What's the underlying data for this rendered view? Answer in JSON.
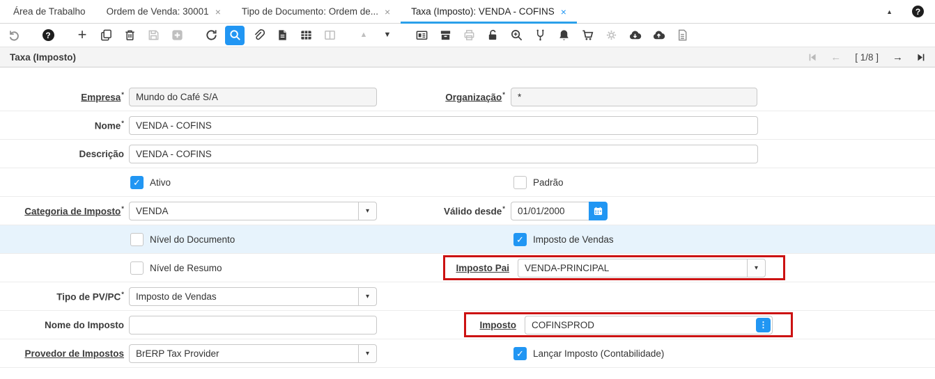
{
  "colors": {
    "accent_blue": "#2196f3",
    "annotation_red": "#cc1212",
    "highlight_row": "#e7f3fc"
  },
  "icons": {
    "check": "✓",
    "combo_caret": "▾",
    "dots": "⋮",
    "close": "×",
    "collapse": "▲",
    "help": "?",
    "prev_arrow": "←",
    "next_arrow": "→"
  },
  "tab_bar": {
    "tabs": [
      {
        "label": "Área de Trabalho",
        "closable": false,
        "active": false
      },
      {
        "label": "Ordem de Venda: 30001",
        "closable": true,
        "active": false
      },
      {
        "label": "Tipo de Documento: Ordem de...",
        "closable": true,
        "active": false
      },
      {
        "label": "Taxa (Imposto): VENDA - COFINS",
        "closable": true,
        "active": true
      }
    ]
  },
  "toolbar": {
    "icons": [
      {
        "name": "undo",
        "state": "muted",
        "gap_after": true
      },
      {
        "name": "help",
        "state": "normal",
        "gap_after": true
      },
      {
        "name": "new-record",
        "state": "normal"
      },
      {
        "name": "copy-record",
        "state": "normal"
      },
      {
        "name": "delete-record",
        "state": "normal"
      },
      {
        "name": "save",
        "state": "disabled"
      },
      {
        "name": "save-create",
        "state": "disabled",
        "gap_after": true
      },
      {
        "name": "refresh",
        "state": "normal"
      },
      {
        "name": "find",
        "state": "active"
      },
      {
        "name": "attachment",
        "state": "normal"
      },
      {
        "name": "report",
        "state": "normal"
      },
      {
        "name": "grid-toggle",
        "state": "normal"
      },
      {
        "name": "detail-window",
        "state": "disabled",
        "gap_after": true
      },
      {
        "name": "parent-record",
        "state": "disabled"
      },
      {
        "name": "detail-record",
        "state": "normal",
        "gap_after": true
      },
      {
        "name": "report-viewer",
        "state": "normal"
      },
      {
        "name": "archive",
        "state": "normal"
      },
      {
        "name": "print",
        "state": "disabled"
      },
      {
        "name": "private-lock",
        "state": "normal"
      },
      {
        "name": "zoom-across",
        "state": "normal"
      },
      {
        "name": "workflow",
        "state": "normal"
      },
      {
        "name": "notifications",
        "state": "normal"
      },
      {
        "name": "requests",
        "state": "normal"
      },
      {
        "name": "preferences",
        "state": "disabled"
      },
      {
        "name": "export",
        "state": "normal"
      },
      {
        "name": "import",
        "state": "normal"
      },
      {
        "name": "csv-log",
        "state": "muted"
      }
    ]
  },
  "title_bar": {
    "title": "Taxa (Imposto)",
    "record_indicator": "[ 1/8 ]"
  },
  "form": {
    "required_glyph": "*",
    "fields": {
      "empresa": {
        "label": "Empresa",
        "value": "Mundo do Café S/A"
      },
      "organizacao": {
        "label": "Organização",
        "value": "*"
      },
      "nome": {
        "label": "Nome",
        "value": "VENDA - COFINS"
      },
      "descricao": {
        "label": "Descrição",
        "value": "VENDA - COFINS"
      },
      "ativo": {
        "label": "Ativo",
        "checked": true
      },
      "padrao": {
        "label": "Padrão",
        "checked": false
      },
      "categoria_imposto": {
        "label": "Categoria de Imposto",
        "value": "VENDA"
      },
      "valido_desde": {
        "label": "Válido desde",
        "value": "01/01/2000"
      },
      "nivel_documento": {
        "label": "Nível do Documento",
        "checked": false
      },
      "imposto_vendas": {
        "label": "Imposto de Vendas",
        "checked": true
      },
      "nivel_resumo": {
        "label": "Nível de Resumo",
        "checked": false
      },
      "imposto_pai": {
        "label": "Imposto Pai",
        "value": "VENDA-PRINCIPAL"
      },
      "tipo_pv_pc": {
        "label": "Tipo de PV/PC",
        "value": "Imposto de Vendas"
      },
      "nome_imposto": {
        "label": "Nome do Imposto",
        "value": ""
      },
      "imposto": {
        "label": "Imposto",
        "value": "COFINSPROD"
      },
      "provedor": {
        "label": "Provedor de Impostos",
        "value": "BrERP Tax Provider"
      },
      "lancar_imposto": {
        "label": "Lançar Imposto (Contabilidade)",
        "checked": true
      }
    }
  }
}
